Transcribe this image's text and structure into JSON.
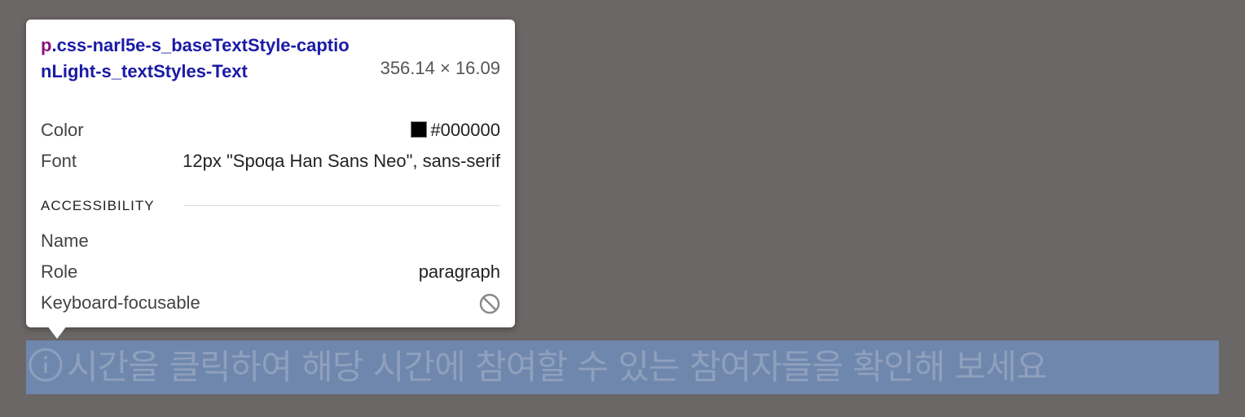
{
  "inspector": {
    "tag": "p",
    "selector": ".css-narl5e-s_baseTextStyle-captionLight-s_textStyles-Text",
    "dimensions": "356.14 × 16.09",
    "color_label": "Color",
    "color_value": "#000000",
    "font_label": "Font",
    "font_value": "12px \"Spoqa Han Sans Neo\", sans-serif",
    "accessibility_heading": "ACCESSIBILITY",
    "name_label": "Name",
    "name_value": "",
    "role_label": "Role",
    "role_value": "paragraph",
    "focusable_label": "Keyboard-focusable",
    "focusable_icon": "not-allowed-icon"
  },
  "element": {
    "icon": "info-icon",
    "text": "시간을 클릭하여 해당 시간에 참여할 수 있는 참여자들을 확인해 보세요"
  },
  "colors": {
    "backdrop": "#6b6766",
    "highlight": "#6f87ad",
    "tag": "#881280",
    "selector": "#1a1aa6"
  }
}
